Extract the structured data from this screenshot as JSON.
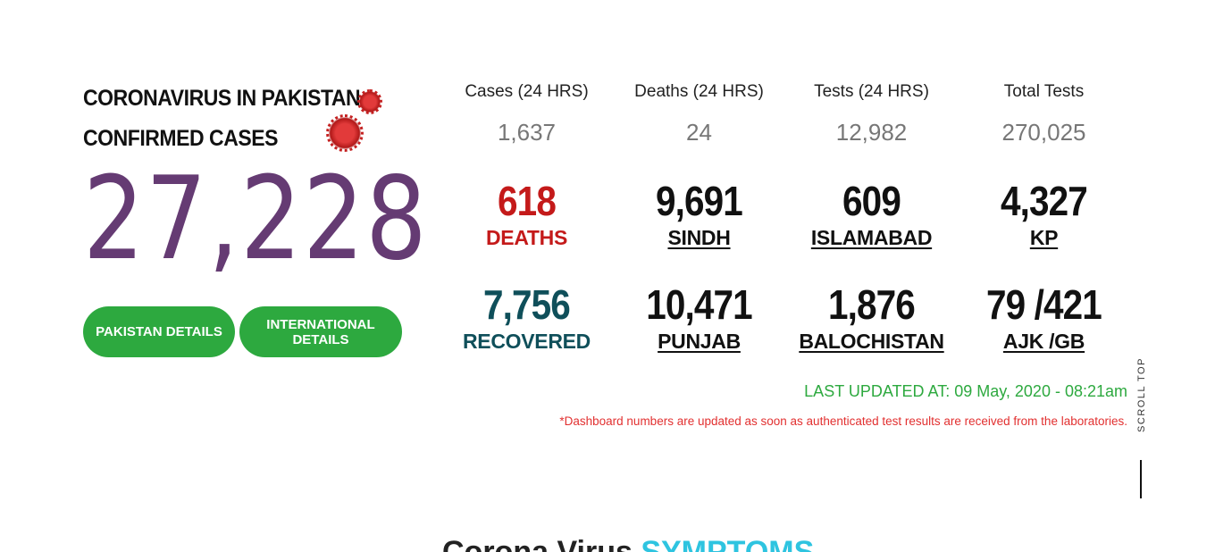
{
  "hero": {
    "title_line1": "CORONAVIRUS IN PAKISTAN",
    "title_line2": "CONFIRMED CASES",
    "confirmed_total": "27,228",
    "buttons": {
      "pakistan": "PAKISTAN DETAILS",
      "international": "INTERNATIONAL DETAILS"
    }
  },
  "headline_stats": [
    {
      "label": "Cases (24 HRS)",
      "value": "1,637"
    },
    {
      "label": "Deaths (24 HRS)",
      "value": "24"
    },
    {
      "label": "Tests (24 HRS)",
      "value": "12,982"
    },
    {
      "label": "Total Tests",
      "value": "270,025"
    }
  ],
  "row1": [
    {
      "value": "618",
      "label": "DEATHS"
    },
    {
      "value": "9,691",
      "label": "SINDH"
    },
    {
      "value": "609",
      "label": "ISLAMABAD"
    },
    {
      "value": "4,327",
      "label": "KP"
    }
  ],
  "row2": [
    {
      "value": "7,756",
      "label": "RECOVERED"
    },
    {
      "value": "10,471",
      "label": "PUNJAB"
    },
    {
      "value": "1,876",
      "label": "BALOCHISTAN"
    },
    {
      "value": "79 /421",
      "label": "AJK /GB"
    }
  ],
  "last_updated": "LAST UPDATED AT: 09 May, 2020 - 08:21am",
  "disclaimer": "*Dashboard numbers are updated as soon as authenticated test results are received from the laboratories.",
  "scroll_top": "SCROLL TOP",
  "bottom": {
    "part1": "Corona Virus",
    "part2": "SYMPTOMS"
  },
  "colors": {
    "confirmed": "#653b73",
    "button_bg": "#2da93f",
    "deaths": "#c41a1a",
    "recovered": "#0f4f5a",
    "last_updated": "#2da93f",
    "disclaimer": "#e23030"
  },
  "icons": [
    "virus-icon-small",
    "virus-icon-large"
  ]
}
